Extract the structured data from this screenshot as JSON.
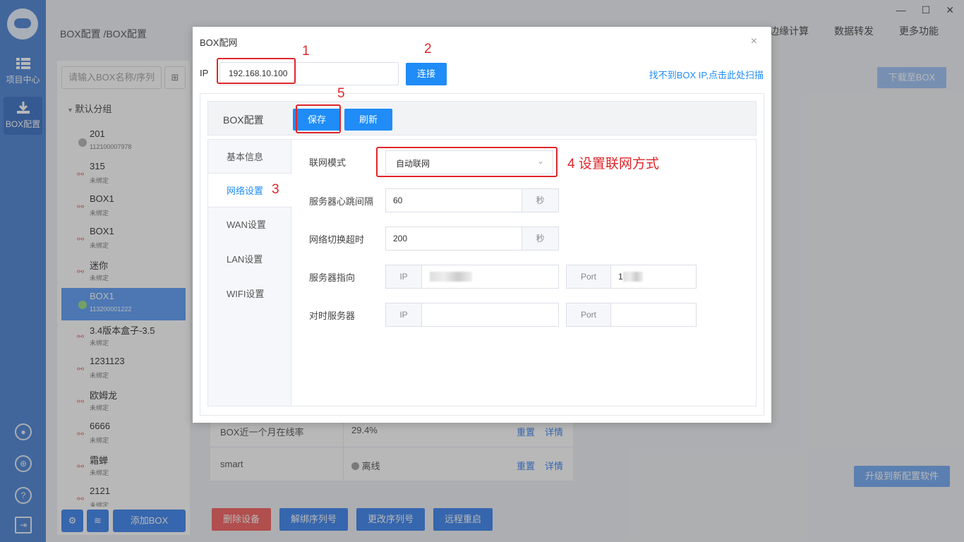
{
  "rail": {
    "items": [
      {
        "label": "项目中心",
        "icon": "grid-icon"
      },
      {
        "label": "BOX配置",
        "icon": "download-icon"
      }
    ]
  },
  "header": {
    "breadcrumb": "BOX配置 /BOX配置",
    "nav": [
      "边缘计算",
      "数据转发",
      "更多功能"
    ]
  },
  "left_panel": {
    "search_placeholder": "请输入BOX名称/序列",
    "group": "默认分组",
    "devices": [
      {
        "name": "201",
        "sub": "112100007978",
        "status": "offline"
      },
      {
        "name": "315",
        "sub": "未绑定",
        "status": "unbound"
      },
      {
        "name": "BOX1",
        "sub": "未绑定",
        "status": "unbound"
      },
      {
        "name": "BOX1",
        "sub": "未绑定",
        "status": "unbound"
      },
      {
        "name": "迷你",
        "sub": "未绑定",
        "status": "unbound"
      },
      {
        "name": "BOX1",
        "sub": "113200001222",
        "status": "online"
      },
      {
        "name": "3.4版本盒子-3.5",
        "sub": "未绑定",
        "status": "unbound"
      },
      {
        "name": "1231123",
        "sub": "未绑定",
        "status": "unbound"
      },
      {
        "name": "欧姆龙",
        "sub": "未绑定",
        "status": "unbound"
      },
      {
        "name": "6666",
        "sub": "未绑定",
        "status": "unbound"
      },
      {
        "name": "霜蝉",
        "sub": "未绑定",
        "status": "unbound"
      },
      {
        "name": "2121",
        "sub": "未绑定",
        "status": "unbound"
      }
    ],
    "add_button": "添加BOX"
  },
  "main": {
    "download_button": "下载至BOX",
    "upgrade_button": "升级到新配置软件",
    "info_rows": [
      {
        "key": "BOX近一个月在线率",
        "value": "29.4%",
        "a1": "重置",
        "a2": "详情"
      },
      {
        "key": "smart",
        "value": "离线",
        "a1": "重置",
        "a2": "详情"
      }
    ],
    "actions": [
      "删除设备",
      "解绑序列号",
      "更改序列号",
      "远程重启"
    ],
    "colors": {
      "danger": "#f56c6c",
      "primary": "#4b8ef0"
    }
  },
  "dialog": {
    "title": "BOX配网",
    "ip_label": "IP",
    "ip_value": "192.168.10.100",
    "connect_button": "连接",
    "scan_link": "找不到BOX IP,点击此处扫描",
    "config_title": "BOX配置",
    "save_button": "保存",
    "refresh_button": "刷新",
    "tabs": [
      "基本信息",
      "网络设置",
      "WAN设置",
      "LAN设置",
      "WIFI设置"
    ],
    "active_tab": "网络设置",
    "form": {
      "mode_label": "联网模式",
      "mode_value": "自动联网",
      "heartbeat_label": "服务器心跳间隔",
      "heartbeat_value": "60",
      "heartbeat_unit": "秒",
      "timeout_label": "网络切换超时",
      "timeout_value": "200",
      "timeout_unit": "秒",
      "server_label": "服务器指向",
      "ip_addon": "IP",
      "port_addon": "Port",
      "server_port_partial": "1",
      "time_label": "对时服务器"
    }
  },
  "annotations": {
    "n1": "1",
    "n2": "2",
    "n3": "3",
    "n4": "4 设置联网方式",
    "n5": "5",
    "color": "#e0262a"
  }
}
